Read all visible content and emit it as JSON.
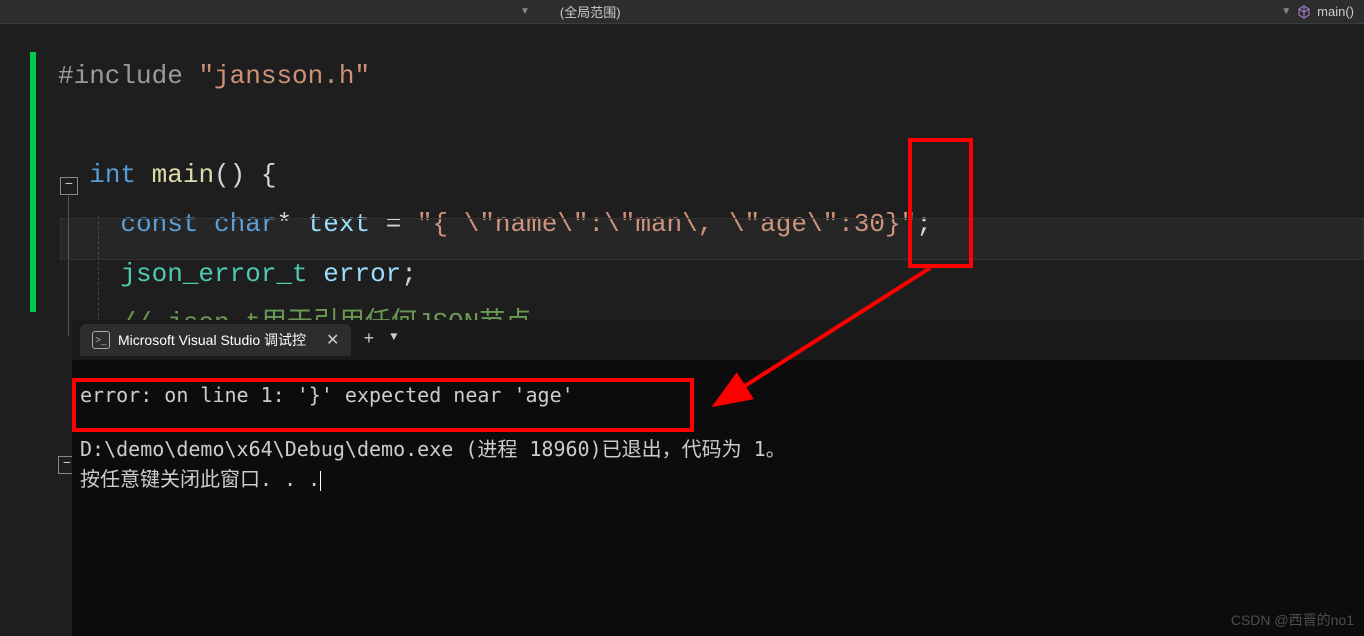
{
  "topbar": {
    "scope_label": "(全局范围)",
    "right_scope": "main()"
  },
  "code": {
    "line1_preproc": "#include ",
    "line1_str": "\"jansson.h\"",
    "line2_kw1": "int",
    "line2_func": " main",
    "line2_rest": "() {",
    "line3_indent": "    ",
    "line3_kw": "const char",
    "line3_star": "* ",
    "line3_var": "text",
    "line3_eq": " = ",
    "line3_str": "\"{ \\\"name\\\":\\\"man\\, \\\"age\\\":30}\"",
    "line3_semi": ";",
    "line4_indent": "    ",
    "line4_type": "json_error_t",
    "line4_var": " error",
    "line4_semi": ";",
    "line5_indent": "    ",
    "line5_comment": "// json_t用于引用任何JSON节点"
  },
  "terminal": {
    "tab_title": "Microsoft Visual Studio 调试控",
    "error_line": "error: on line 1: '}' expected near 'age'",
    "exit_line": "D:\\demo\\demo\\x64\\Debug\\demo.exe (进程 18960)已退出，代码为 1。",
    "prompt_line": "按任意键关闭此窗口. . ."
  },
  "watermark": "CSDN @西晋的no1"
}
